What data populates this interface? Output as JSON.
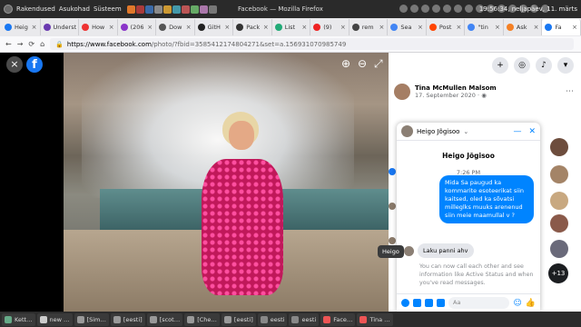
{
  "system": {
    "apps_label": "Rakendused",
    "places_label": "Asukohad",
    "system_label": "Süsteem",
    "window_title": "Facebook — Mozilla Firefox",
    "clock": "19:56:34, neljapäev, 11. märts"
  },
  "tabs": [
    {
      "label": "Heig",
      "color": "#1877f2"
    },
    {
      "label": "Underst",
      "color": "#6a3ab0"
    },
    {
      "label": "How",
      "color": "#e33"
    },
    {
      "label": "(206",
      "color": "#8a35c9"
    },
    {
      "label": "Dow",
      "color": "#555"
    },
    {
      "label": "GitH",
      "color": "#222"
    },
    {
      "label": "Pack",
      "color": "#333"
    },
    {
      "label": "List",
      "color": "#2a7"
    },
    {
      "label": "(9)",
      "color": "#e22"
    },
    {
      "label": "rem",
      "color": "#444"
    },
    {
      "label": "Sea",
      "color": "#4285f4"
    },
    {
      "label": "Post",
      "color": "#ff4500"
    },
    {
      "label": "\"tin",
      "color": "#4285f4"
    },
    {
      "label": "Ask",
      "color": "#f48024"
    },
    {
      "label": "Fa",
      "color": "#1877f2",
      "active": true
    }
  ],
  "browser": {
    "url_domain": "https://www.facebook.com",
    "url_rest": "/photo/?fbid=3585412174804271&set=a.156931070985749"
  },
  "viewer": {
    "close_icon": "×",
    "fb_logo": "f",
    "zoom_in": "⊕",
    "zoom_out": "⊖",
    "fullscreen": "⤢"
  },
  "post": {
    "author": "Tina McMullen Malsom",
    "date": "17. September 2020",
    "date_suffix": "·"
  },
  "chat": {
    "header_name": "Heigo Jõgisoo",
    "header_chevron": "⌄",
    "minimize": "—",
    "close": "✕",
    "profile_name": "Heigo Jõgisoo",
    "time": "7:26 PM",
    "outgoing": "Mida Sa paugud ka kommarite  esoteerikat siin kaitsed, oled ka sõvatsi milleglks muuks arenenud siin meie maamullal v ?",
    "incoming": "Laku panni ahv",
    "info_text": "You can now call each other and see information like Active Status and when you've read messages.",
    "input_placeholder": "Aa"
  },
  "tooltip": "Heigo",
  "more_contacts": "+13",
  "taskbar": [
    {
      "label": "Kett…",
      "color": "#6a8"
    },
    {
      "label": "new …",
      "color": "#ccc"
    },
    {
      "label": "[Sim…",
      "color": "#999"
    },
    {
      "label": "[eesti]",
      "color": "#999"
    },
    {
      "label": "[scot…",
      "color": "#999"
    },
    {
      "label": "[Che…",
      "color": "#999"
    },
    {
      "label": "[eesti]",
      "color": "#999"
    },
    {
      "label": "eesti",
      "color": "#888"
    },
    {
      "label": "eesti",
      "color": "#888"
    },
    {
      "label": "Face…",
      "color": "#e55"
    },
    {
      "label": "Tina …",
      "color": "#e55"
    }
  ]
}
